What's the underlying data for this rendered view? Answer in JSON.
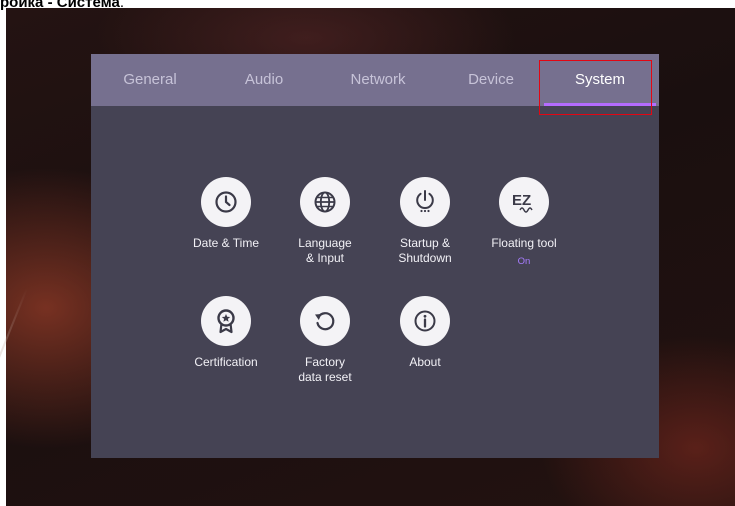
{
  "caption": {
    "part1": "ройка",
    "sep": " - ",
    "part2": "Система",
    "tail": "."
  },
  "tabs": [
    {
      "label": "General"
    },
    {
      "label": "Audio"
    },
    {
      "label": "Network"
    },
    {
      "label": "Device"
    },
    {
      "label": "System"
    }
  ],
  "active_tab": "System",
  "items": [
    {
      "label": "Date & Time",
      "icon": "clock-icon"
    },
    {
      "label": "Language\n& Input",
      "icon": "globe-icon"
    },
    {
      "label": "Startup &\nShutdown",
      "icon": "power-icon"
    },
    {
      "label": "Floating tool",
      "icon": "ez-icon",
      "status": "On"
    },
    {
      "label": "Certification",
      "icon": "certificate-icon"
    },
    {
      "label": "Factory\ndata reset",
      "icon": "reset-icon"
    },
    {
      "label": "About",
      "icon": "info-icon"
    }
  ],
  "colors": {
    "tabbar": "#76708f",
    "panel": "#454354",
    "accent": "#b46cff",
    "highlight": "#e30613"
  }
}
